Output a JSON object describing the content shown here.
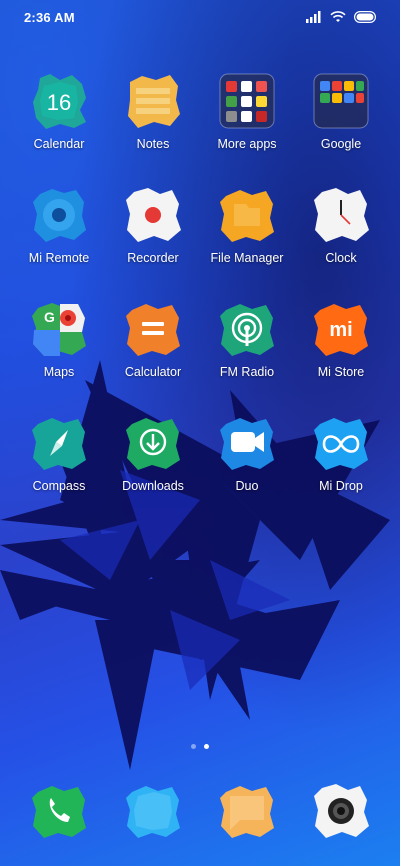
{
  "status_bar": {
    "time": "2:36 AM"
  },
  "apps": [
    {
      "label": "Calendar",
      "icon": "calendar-icon",
      "day": "16"
    },
    {
      "label": "Notes",
      "icon": "notes-icon"
    },
    {
      "label": "More apps",
      "icon": "folder-icon"
    },
    {
      "label": "Google",
      "icon": "folder-icon"
    },
    {
      "label": "Mi Remote",
      "icon": "remote-icon"
    },
    {
      "label": "Recorder",
      "icon": "recorder-icon"
    },
    {
      "label": "File Manager",
      "icon": "file-manager-icon"
    },
    {
      "label": "Clock",
      "icon": "clock-icon"
    },
    {
      "label": "Maps",
      "icon": "maps-icon"
    },
    {
      "label": "Calculator",
      "icon": "calculator-icon"
    },
    {
      "label": "FM Radio",
      "icon": "radio-icon"
    },
    {
      "label": "Mi Store",
      "icon": "store-icon",
      "logo": "mi"
    },
    {
      "label": "Compass",
      "icon": "compass-icon"
    },
    {
      "label": "Downloads",
      "icon": "downloads-icon"
    },
    {
      "label": "Duo",
      "icon": "duo-icon"
    },
    {
      "label": "Mi Drop",
      "icon": "mi-drop-icon"
    }
  ],
  "page_indicator": {
    "pages": 2,
    "current": 2
  },
  "dock": [
    {
      "icon": "phone-icon"
    },
    {
      "icon": "messages-icon"
    },
    {
      "icon": "chat-icon"
    },
    {
      "icon": "camera-icon"
    }
  ]
}
